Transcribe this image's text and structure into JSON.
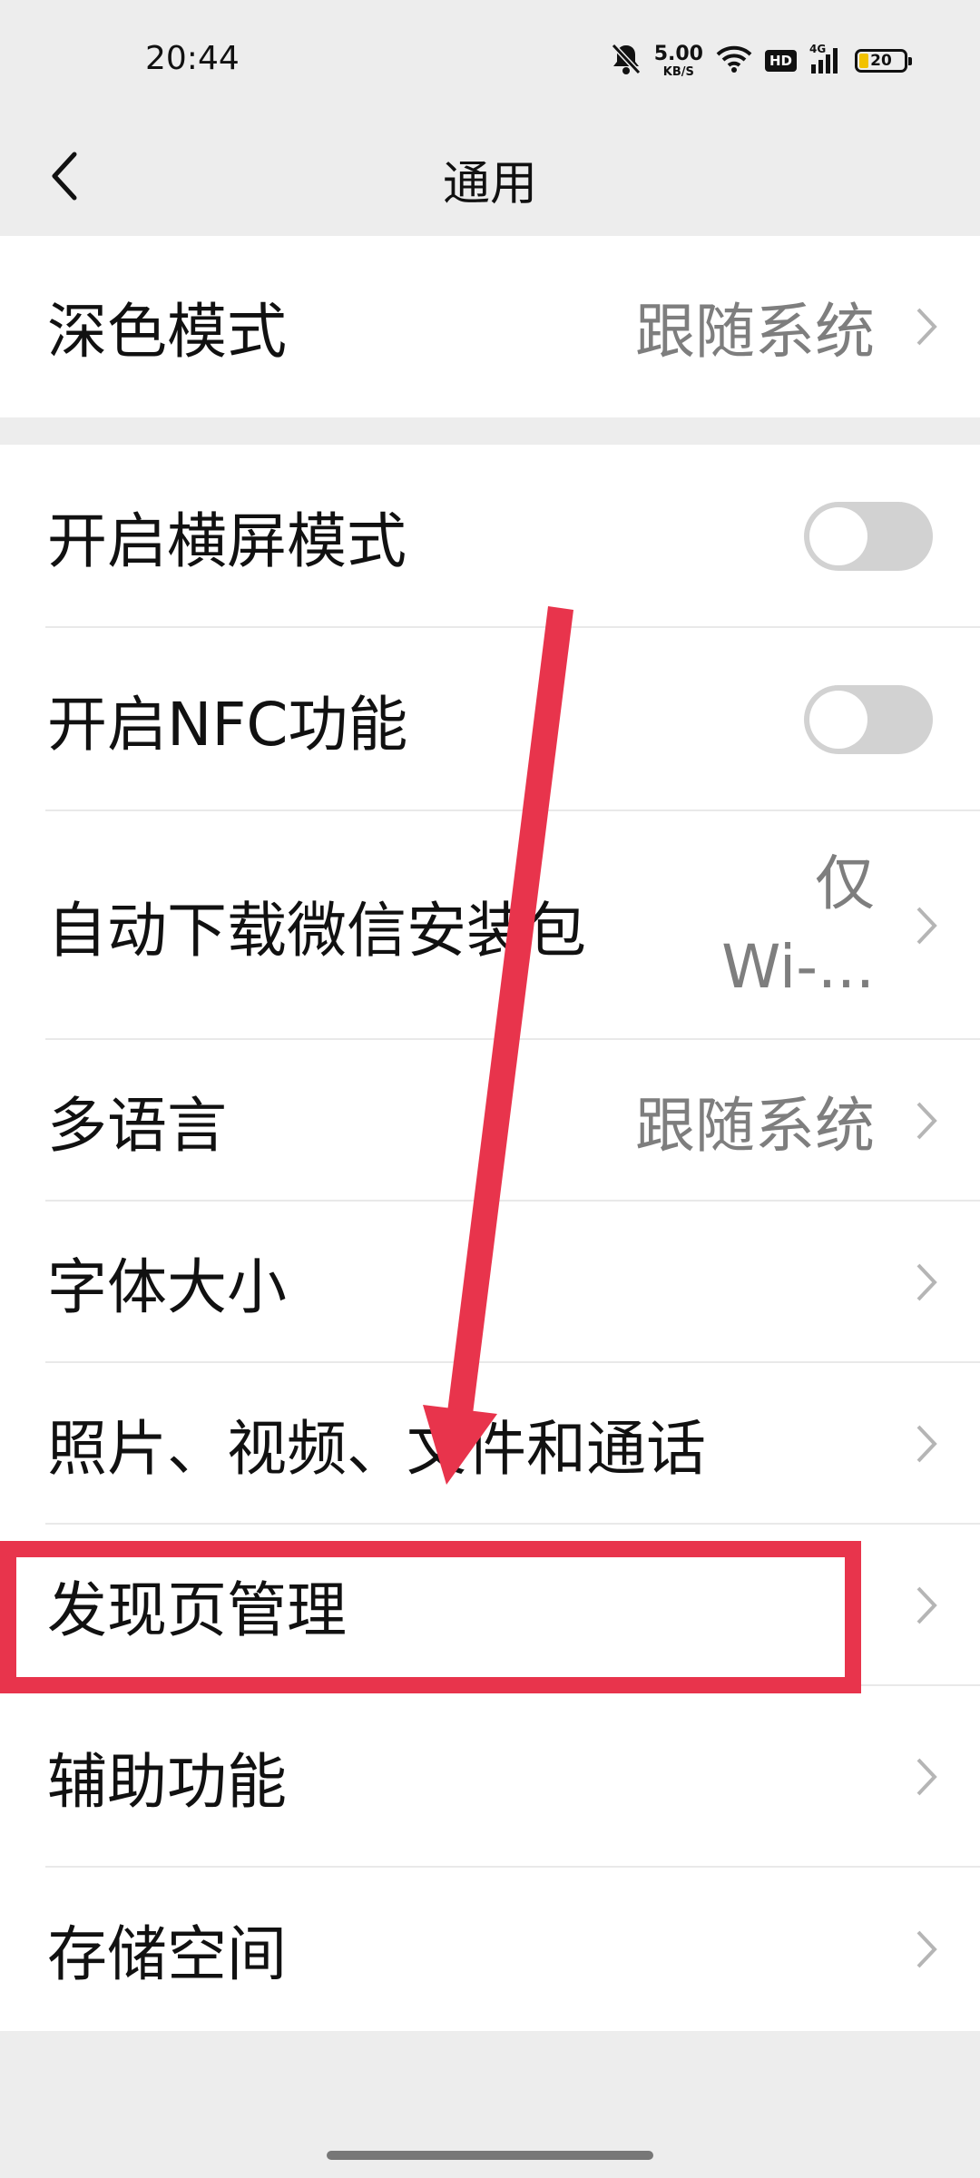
{
  "status_bar": {
    "time": "20:44",
    "net_speed_value": "5.00",
    "net_speed_unit": "KB/S",
    "hd_badge": "HD",
    "signal_label": "4G",
    "battery": "20",
    "icons": [
      "mute-bell-icon",
      "wifi-icon",
      "hd-icon",
      "signal-icon",
      "battery-icon"
    ]
  },
  "header": {
    "title": "通用",
    "back_icon": "chevron-left-icon"
  },
  "group1": {
    "dark_mode": {
      "label": "深色模式",
      "value": "跟随系统"
    }
  },
  "group2": {
    "landscape": {
      "label": "开启横屏模式",
      "enabled": false
    },
    "nfc": {
      "label": "开启NFC功能",
      "enabled": false
    },
    "auto_download": {
      "label": "自动下载微信安装包",
      "value_line1": "仅",
      "value_line2": "Wi-..."
    },
    "language": {
      "label": "多语言",
      "value": "跟随系统"
    },
    "font_size": {
      "label": "字体大小"
    },
    "media": {
      "label": "照片、视频、文件和通话"
    },
    "discover": {
      "label": "发现页管理"
    },
    "accessibility": {
      "label": "辅助功能"
    },
    "storage": {
      "label": "存储空间"
    }
  },
  "colors": {
    "annotation_red": "#e8344c",
    "background": "#ededed",
    "toggle_off": "#d2d2d2"
  }
}
